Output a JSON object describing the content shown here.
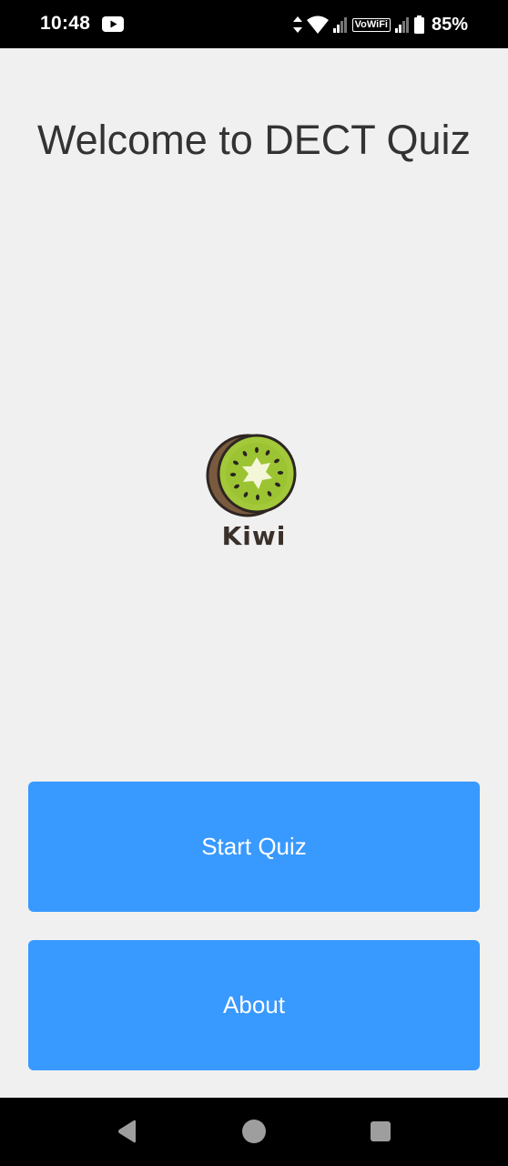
{
  "status_bar": {
    "time": "10:48",
    "vowifi": "VoWiFi",
    "battery": "85%",
    "icons": [
      "youtube-icon",
      "data-arrows-icon",
      "wifi-icon",
      "signal-icon",
      "signal-icon",
      "battery-icon"
    ]
  },
  "main": {
    "title": "Welcome to DECT Quiz",
    "logo_text": "Kiwi",
    "buttons": {
      "start": "Start Quiz",
      "about": "About"
    }
  },
  "colors": {
    "background": "#f0f0f0",
    "button": "#3899ff",
    "title_text": "#333333"
  },
  "navigation": {
    "icons": [
      "back-icon",
      "home-icon",
      "recents-icon"
    ]
  }
}
